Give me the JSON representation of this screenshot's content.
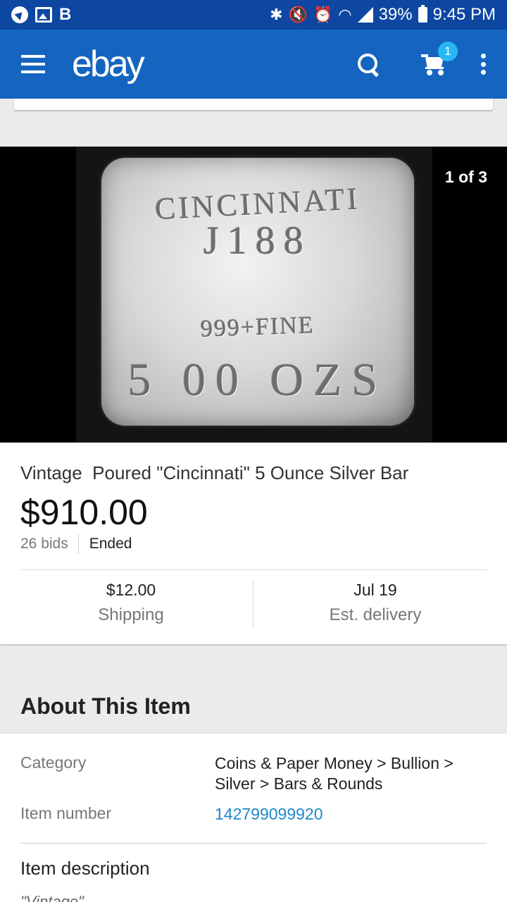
{
  "status_bar": {
    "carrier_letter": "B",
    "battery": "39%",
    "time": "9:45 PM"
  },
  "app_bar": {
    "logo": "ebay",
    "cart_count": "1"
  },
  "gallery": {
    "counter": "1 of 3",
    "engraving": [
      "CINCINNATI",
      "J188",
      "999+FINE",
      "5 00 OZS"
    ]
  },
  "item": {
    "title": "Vintage  Poured \"Cincinnati\" 5 Ounce Silver Bar",
    "price": "$910.00",
    "bids": "26 bids",
    "status": "Ended",
    "shipping_value": "$12.00",
    "shipping_label": "Shipping",
    "delivery_value": "Jul 19",
    "delivery_label": "Est. delivery"
  },
  "about": {
    "heading": "About This Item",
    "category_label": "Category",
    "category_value": "Coins & Paper Money > Bullion > Silver > Bars & Rounds",
    "item_number_label": "Item number",
    "item_number_value": "142799099920",
    "description_heading": "Item description",
    "description_preview": "\"Vintage\""
  },
  "colors": {
    "status_bar": "#0d47a1",
    "app_bar": "#1565c0",
    "badge": "#29b6f6",
    "link": "#1e88c7"
  }
}
